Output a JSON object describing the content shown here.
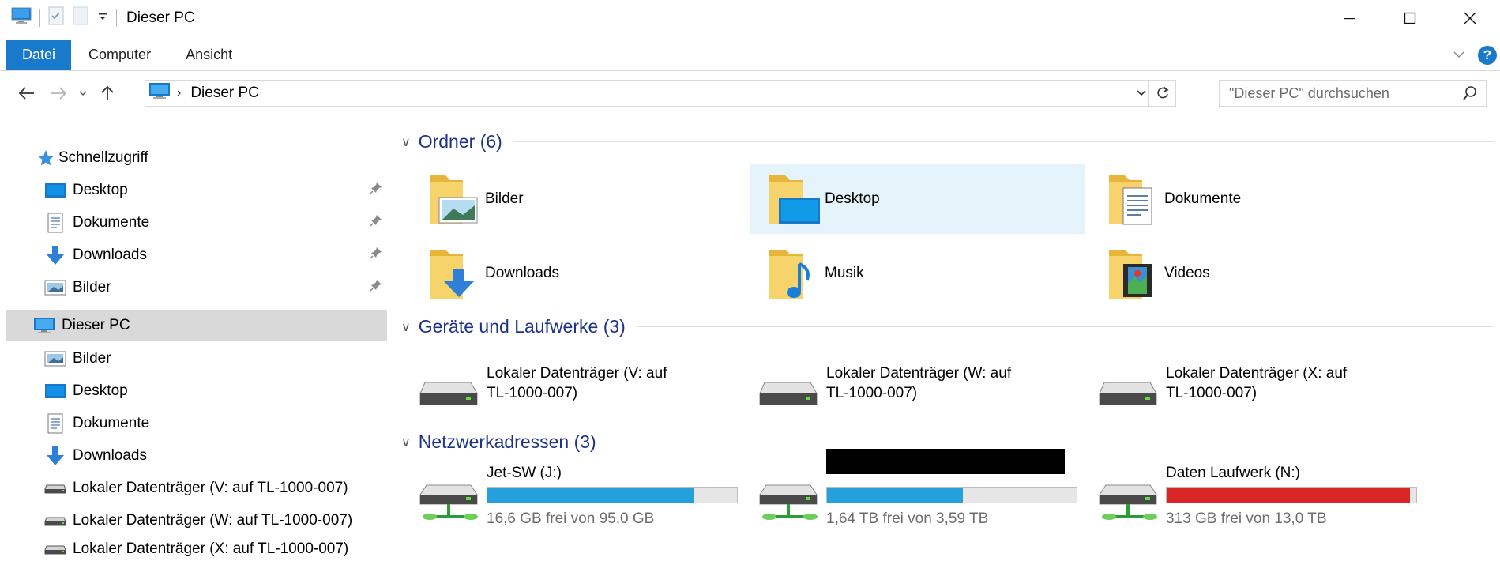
{
  "window": {
    "title": "Dieser PC",
    "minimize": "—",
    "maximize": "☐",
    "close": "✕"
  },
  "ribbon": {
    "tabs": [
      "Datei",
      "Computer",
      "Ansicht"
    ]
  },
  "address": {
    "path_root": "Dieser PC",
    "search_placeholder": "\"Dieser PC\" durchsuchen"
  },
  "sidebar": {
    "quick_access": "Schnellzugriff",
    "quick_items": [
      {
        "label": "Desktop",
        "icon": "desktop-icon"
      },
      {
        "label": "Dokumente",
        "icon": "documents-icon"
      },
      {
        "label": "Downloads",
        "icon": "downloads-icon"
      },
      {
        "label": "Bilder",
        "icon": "pictures-icon"
      }
    ],
    "this_pc": "Dieser PC",
    "pc_items": [
      {
        "label": "Bilder",
        "icon": "pictures-icon"
      },
      {
        "label": "Desktop",
        "icon": "desktop-icon"
      },
      {
        "label": "Dokumente",
        "icon": "documents-icon"
      },
      {
        "label": "Downloads",
        "icon": "downloads-icon"
      },
      {
        "label": "Lokaler Datenträger (V: auf TL-1000-007)",
        "icon": "drive-icon"
      },
      {
        "label": "Lokaler Datenträger (W: auf TL-1000-007)",
        "icon": "drive-icon"
      },
      {
        "label": "Lokaler Datenträger (X: auf TL-1000-007)",
        "icon": "drive-icon"
      }
    ]
  },
  "content": {
    "groups": {
      "folders": "Ordner (6)",
      "devices": "Geräte und Laufwerke (3)",
      "network": "Netzwerkadressen (3)"
    },
    "folders": [
      {
        "label": "Bilder",
        "icon": "pictures-folder-icon"
      },
      {
        "label": "Desktop",
        "icon": "desktop-folder-icon",
        "selected": true
      },
      {
        "label": "Dokumente",
        "icon": "documents-folder-icon"
      },
      {
        "label": "Downloads",
        "icon": "downloads-folder-icon"
      },
      {
        "label": "Musik",
        "icon": "music-folder-icon"
      },
      {
        "label": "Videos",
        "icon": "videos-folder-icon"
      }
    ],
    "drives": [
      {
        "line1": "Lokaler Datenträger (V: auf",
        "line2": "TL-1000-007)"
      },
      {
        "line1": "Lokaler Datenträger (W: auf",
        "line2": "TL-1000-007)"
      },
      {
        "line1": "Lokaler Datenträger (X: auf",
        "line2": "TL-1000-007)"
      }
    ],
    "network": [
      {
        "name": "Jet-SW (J:)",
        "free": "16,6 GB frei von 95,0 GB",
        "used_fraction": 0.825,
        "color": "#26a0da"
      },
      {
        "name": "",
        "free": "1,64 TB frei von 3,59 TB",
        "used_fraction": 0.543,
        "color": "#26a0da",
        "redacted": true
      },
      {
        "name": "Daten Laufwerk (N:)",
        "free": "313 GB frei von 13,0 TB",
        "used_fraction": 0.976,
        "color": "#da2626"
      }
    ]
  }
}
